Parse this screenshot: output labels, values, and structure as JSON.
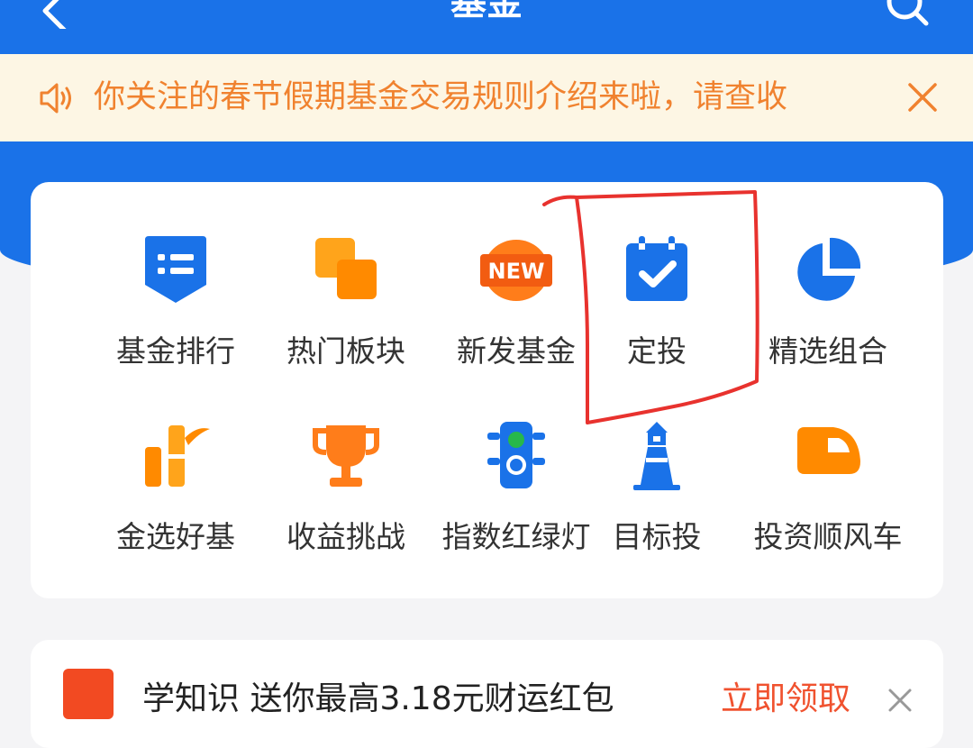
{
  "header": {
    "title": "基金",
    "back_icon": "back-arrow-icon",
    "search_icon": "search-icon",
    "color": "#1a72e8"
  },
  "notice": {
    "text": "你关注的春节假期基金交易规则介绍来啦，请查收",
    "icon": "speaker-icon",
    "close_icon": "close-icon",
    "text_color": "#f0822f",
    "background": "#fdf6e4"
  },
  "entries": [
    {
      "label": "基金排行",
      "icon": "fund-ranking-icon"
    },
    {
      "label": "热门板块",
      "icon": "hot-sectors-icon"
    },
    {
      "label": "新发基金",
      "icon": "new-fund-icon",
      "badge": "NEW"
    },
    {
      "label": "定投",
      "icon": "calendar-check-icon"
    },
    {
      "label": "精选组合",
      "icon": "pie-chart-icon"
    },
    {
      "label": "金选好基",
      "icon": "bamboo-icon"
    },
    {
      "label": "收益挑战",
      "icon": "trophy-icon"
    },
    {
      "label": "指数红绿灯",
      "icon": "traffic-light-icon"
    },
    {
      "label": "目标投",
      "icon": "lighthouse-icon"
    },
    {
      "label": "投资顺风车",
      "icon": "train-icon"
    }
  ],
  "highlight": {
    "color": "#e8322e",
    "target": "定投"
  },
  "promo": {
    "text": "学知识 送你最高3.18元财运红包",
    "action": "立即领取",
    "close_icon": "close-icon",
    "accent": "#f0522f"
  }
}
